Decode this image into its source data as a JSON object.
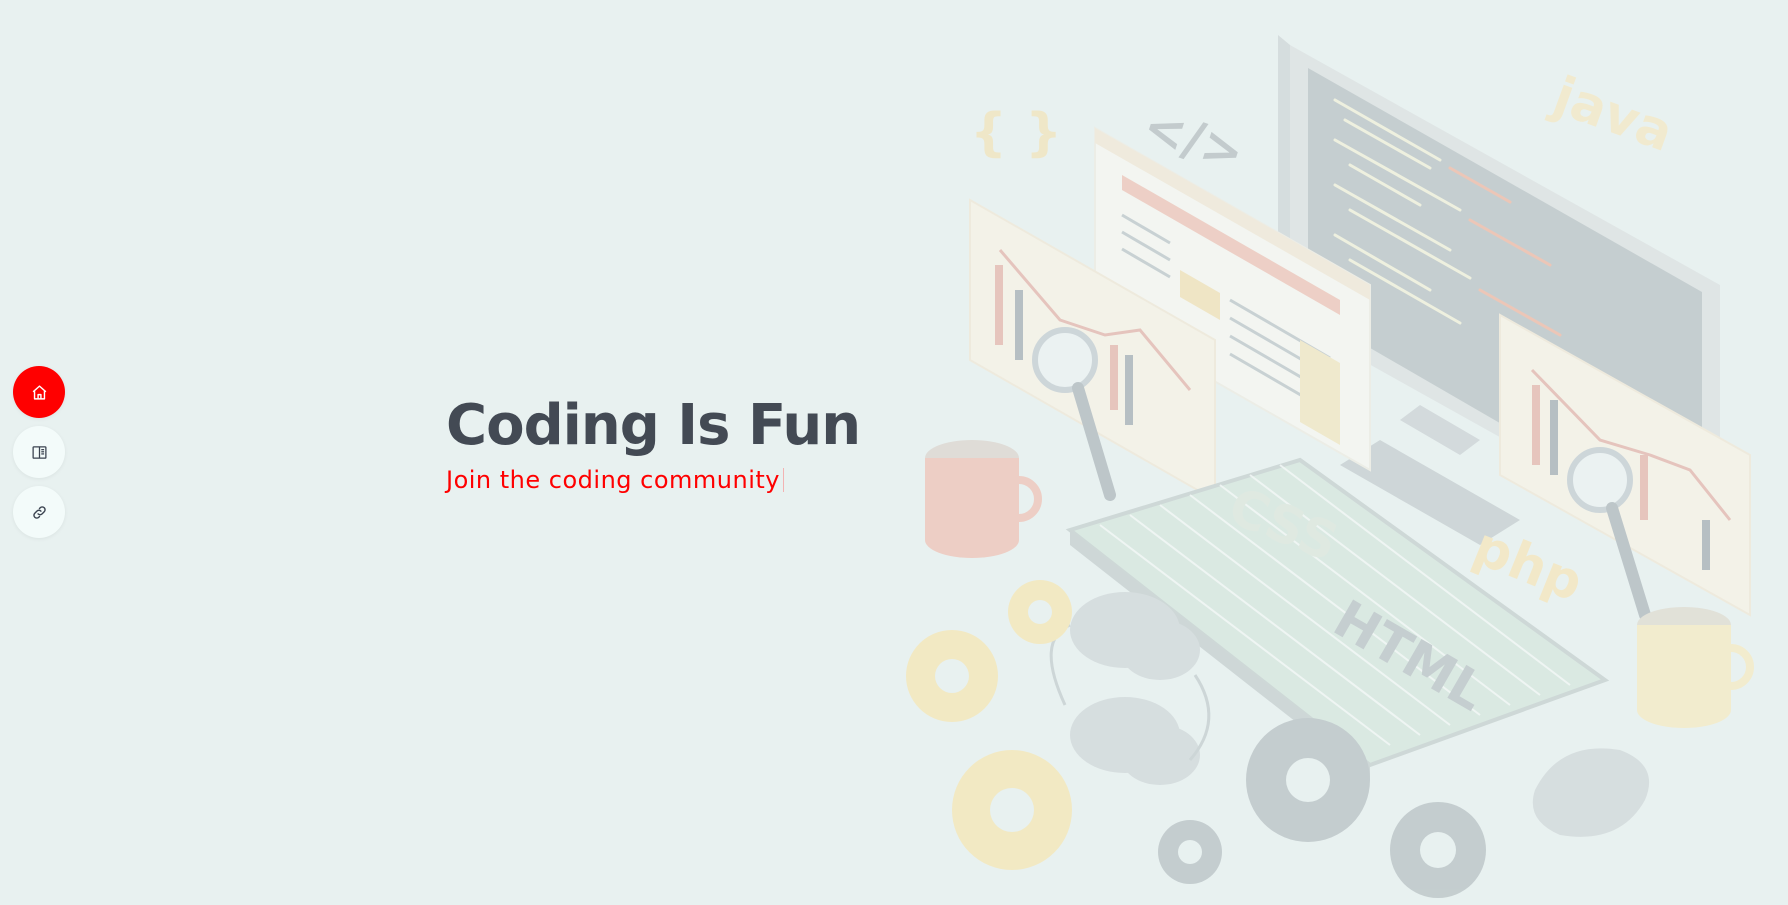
{
  "nav": {
    "items": [
      {
        "icon": "home-icon",
        "active": true
      },
      {
        "icon": "book-icon",
        "active": false
      },
      {
        "icon": "link-icon",
        "active": false
      }
    ]
  },
  "hero": {
    "title": "Coding Is Fun",
    "subtitle": "Join the coding community"
  },
  "illustration": {
    "labels": [
      "{ }",
      "</>",
      "java",
      "CSS",
      "php",
      "HTML"
    ]
  },
  "colors": {
    "background": "#e8f1f0",
    "accent": "#ff0000",
    "title": "#434a54",
    "nav_button": "#f3fbfa"
  }
}
